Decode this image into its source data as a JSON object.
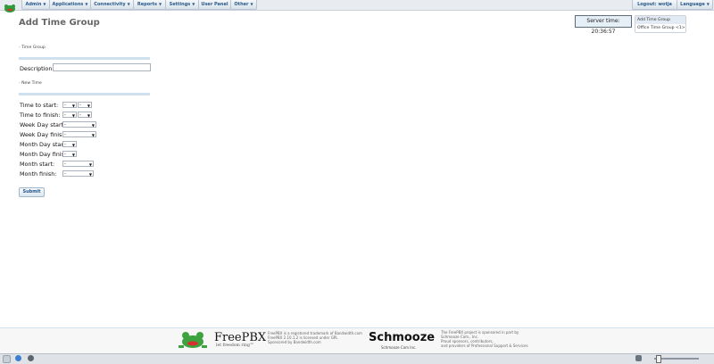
{
  "topnav": {
    "items": [
      {
        "label": "Admin"
      },
      {
        "label": "Applications"
      },
      {
        "label": "Connectivity"
      },
      {
        "label": "Reports"
      },
      {
        "label": "Settings"
      },
      {
        "label": "User Panel"
      },
      {
        "label": "Other"
      }
    ],
    "logout": "Logout: wotja",
    "language": "Language"
  },
  "page": {
    "title": "Add Time Group",
    "server_time": "Server time: 20:36:57"
  },
  "rnav": {
    "items": [
      {
        "label": "Add Time Group"
      },
      {
        "label": "Office Time Group <1>"
      }
    ]
  },
  "form": {
    "section_time_group": "- Time Group",
    "description_label": "Description",
    "description_value": "",
    "section_new_time": "- New Time",
    "rows": [
      {
        "label": "Time to start:",
        "values": [
          "-",
          "-"
        ]
      },
      {
        "label": "Time to finish:",
        "values": [
          "-",
          "-"
        ]
      },
      {
        "label": "Week Day start:",
        "values": [
          "-"
        ]
      },
      {
        "label": "Week Day finish:",
        "values": [
          "-"
        ]
      },
      {
        "label": "Month Day start:",
        "values": [
          "-"
        ]
      },
      {
        "label": "Month Day finish:",
        "values": [
          "-"
        ]
      },
      {
        "label": "Month start:",
        "values": [
          "-"
        ]
      },
      {
        "label": "Month finish:",
        "values": [
          "-"
        ]
      }
    ],
    "submit_label": "Submit"
  },
  "footer": {
    "freepbx_name": "FreePBX",
    "freepbx_tagline": "let freedom ring™",
    "freepbx_note": [
      "FreePBX is a registered trademark of Bandwidth.com",
      "FreePBX 2.10.1.2 is licensed under GPL",
      "Sponsored by Bandwidth.com"
    ],
    "schmooze_name": "Schmooze",
    "schmooze_sub": "Schmooze Com Inc.",
    "schmooze_note": [
      "The FreePBX project is sponsored in part by",
      "Schmooze Com., Inc.",
      "Proud sponsors, contributors,",
      "and providers of Professional Support & Services"
    ]
  },
  "colors": {
    "nav_text": "#2a5a8a",
    "section_line": "#cfe0ee",
    "heading": "#666666"
  }
}
